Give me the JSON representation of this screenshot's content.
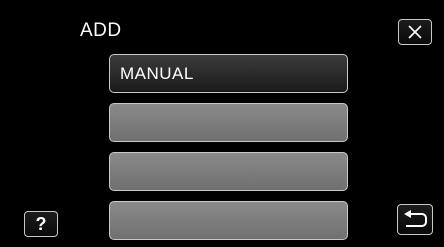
{
  "header": {
    "title": "ADD"
  },
  "icons": {
    "close": "close-icon",
    "help": "question-mark-icon",
    "back": "return-arrow-icon"
  },
  "help_button": {
    "label": "?"
  },
  "list": {
    "items": [
      {
        "label": "MANUAL"
      },
      {
        "label": ""
      },
      {
        "label": ""
      },
      {
        "label": ""
      }
    ]
  }
}
